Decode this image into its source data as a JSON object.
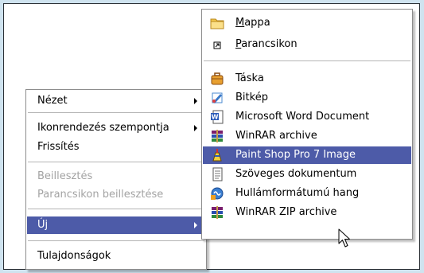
{
  "context_menu": {
    "items": [
      {
        "label": "Nézet",
        "submenu": true
      },
      {
        "label": "Ikonrendezés szempontja",
        "submenu": true
      },
      {
        "label": "Frissítés"
      },
      {
        "label": "Beillesztés",
        "disabled": true
      },
      {
        "label": "Parancsikon beillesztése",
        "disabled": true
      },
      {
        "label": "Új",
        "submenu": true,
        "highlighted": true
      },
      {
        "label": "Tulajdonságok"
      }
    ]
  },
  "new_submenu": {
    "items": [
      {
        "label_rest": "appa",
        "mnemonic": "M",
        "icon": "folder-icon"
      },
      {
        "label_rest": "arancsikon",
        "mnemonic": "P",
        "icon": "shortcut-icon"
      },
      {
        "label": "Táska",
        "icon": "briefcase-icon"
      },
      {
        "label": "Bitkép",
        "icon": "bitmap-paint-icon"
      },
      {
        "label": "Microsoft Word Document",
        "icon": "word-document-icon"
      },
      {
        "label": "WinRAR archive",
        "icon": "winrar-icon"
      },
      {
        "label": "Paint Shop Pro 7 Image",
        "icon": "paint-shop-pro-icon",
        "highlighted": true
      },
      {
        "label": "Szöveges dokumentum",
        "icon": "text-document-icon"
      },
      {
        "label": "Hullámformátumú hang",
        "icon": "wave-sound-icon"
      },
      {
        "label": "WinRAR ZIP archive",
        "icon": "winrar-zip-icon"
      }
    ]
  },
  "colors": {
    "highlight": "#4d5ba8",
    "frame_background": "#cfe3ef",
    "disabled_text": "#a3a3a3"
  }
}
